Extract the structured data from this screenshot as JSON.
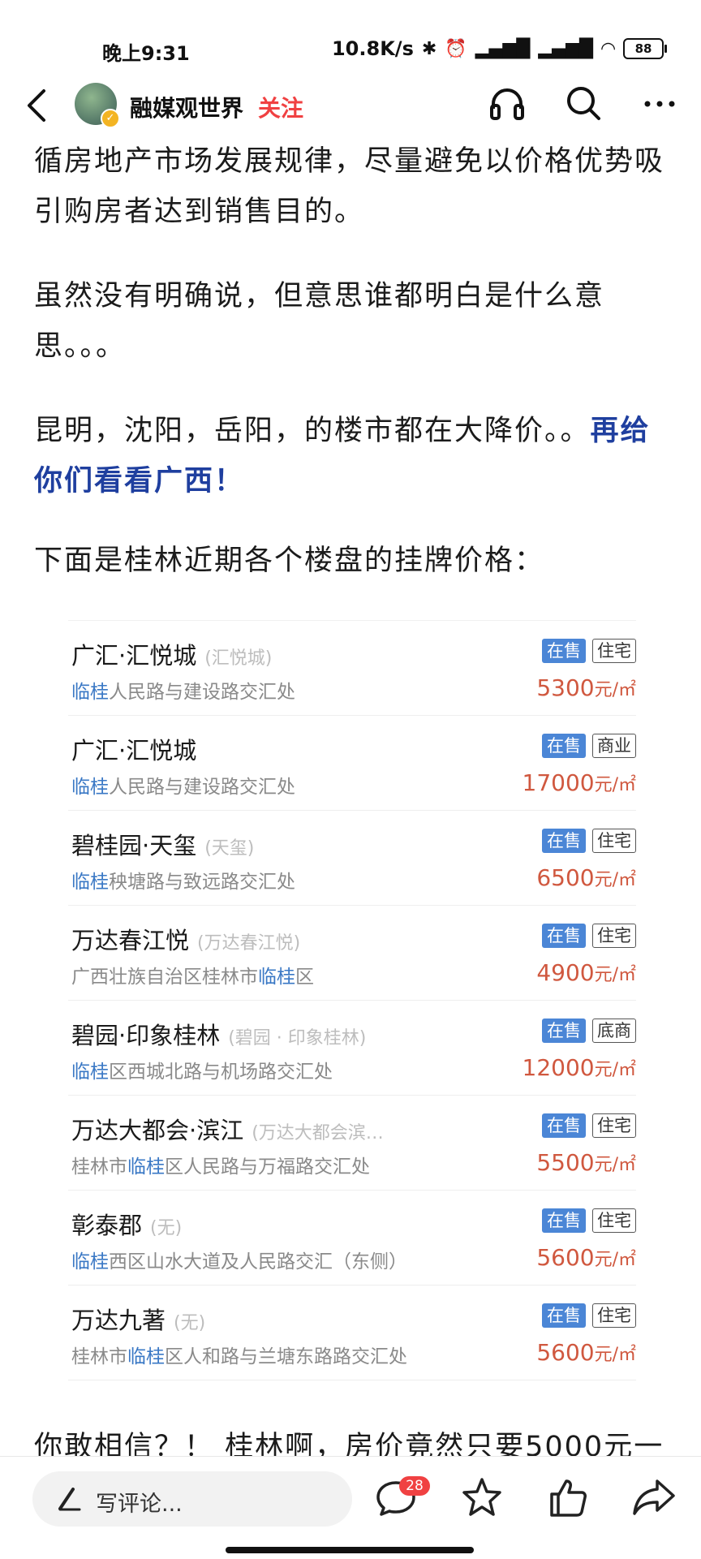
{
  "status_bar": {
    "time": "晚上9:31",
    "network_speed": "10.8K/s",
    "battery": "88"
  },
  "header": {
    "author": "融媒观世界",
    "follow_label": "关注"
  },
  "article": {
    "p1": "循房地产市场发展规律，尽量避免以价格优势吸引购房者达到销售目的。",
    "p2": "虽然没有明确说，但意思谁都明白是什么意思。。。",
    "p3_text": "昆明，沈阳，岳阳，的楼市都在大降价。。",
    "p3_highlight": "再给你们看看广西！",
    "p4": "下面是桂林近期各个楼盘的挂牌价格：",
    "p5": "你敢相信？！ 桂林啊，房价竟然只要5000元一"
  },
  "listings": [
    {
      "name": "广汇·汇悦城",
      "alias": "(汇悦城)",
      "addr_kw": "临桂",
      "addr_pre": "",
      "addr_post": "人民路与建设路交汇处",
      "status": "在售",
      "type": "住宅",
      "price": "5300",
      "unit": "元/㎡"
    },
    {
      "name": "广汇·汇悦城",
      "alias": "",
      "addr_kw": "临桂",
      "addr_pre": "",
      "addr_post": "人民路与建设路交汇处",
      "status": "在售",
      "type": "商业",
      "price": "17000",
      "unit": "元/㎡"
    },
    {
      "name": "碧桂园·天玺",
      "alias": "(天玺)",
      "addr_kw": "临桂",
      "addr_pre": "",
      "addr_post": "秧塘路与致远路交汇处",
      "status": "在售",
      "type": "住宅",
      "price": "6500",
      "unit": "元/㎡"
    },
    {
      "name": "万达春江悦",
      "alias": "(万达春江悦)",
      "addr_kw": "临桂",
      "addr_pre": "广西壮族自治区桂林市",
      "addr_post": "区",
      "status": "在售",
      "type": "住宅",
      "price": "4900",
      "unit": "元/㎡"
    },
    {
      "name": "碧园·印象桂林",
      "alias": "(碧园 · 印象桂林)",
      "addr_kw": "临桂",
      "addr_pre": "",
      "addr_post": "区西城北路与机场路交汇处",
      "status": "在售",
      "type": "底商",
      "price": "12000",
      "unit": "元/㎡"
    },
    {
      "name": "万达大都会·滨江",
      "alias": "(万达大都会滨…",
      "addr_kw": "临桂",
      "addr_pre": "桂林市",
      "addr_post": "区人民路与万福路交汇处",
      "status": "在售",
      "type": "住宅",
      "price": "5500",
      "unit": "元/㎡"
    },
    {
      "name": "彰泰郡",
      "alias": "(无)",
      "addr_kw": "临桂",
      "addr_pre": "",
      "addr_post": "西区山水大道及人民路交汇（东侧）",
      "status": "在售",
      "type": "住宅",
      "price": "5600",
      "unit": "元/㎡"
    },
    {
      "name": "万达九著",
      "alias": "(无)",
      "addr_kw": "临桂",
      "addr_pre": "桂林市",
      "addr_post": "区人和路与兰塘东路路交汇处",
      "status": "在售",
      "type": "住宅",
      "price": "5600",
      "unit": "元/㎡"
    }
  ],
  "bottom_bar": {
    "comment_placeholder": "写评论...",
    "comment_count": "28"
  },
  "icons": {
    "back": "back-arrow-icon",
    "listen": "headphones-icon",
    "search": "search-icon",
    "more": "more-dots-icon",
    "pen": "pen-icon",
    "comment": "comment-bubble-icon",
    "favorite": "star-icon",
    "like": "thumbs-up-icon",
    "share": "share-icon"
  }
}
